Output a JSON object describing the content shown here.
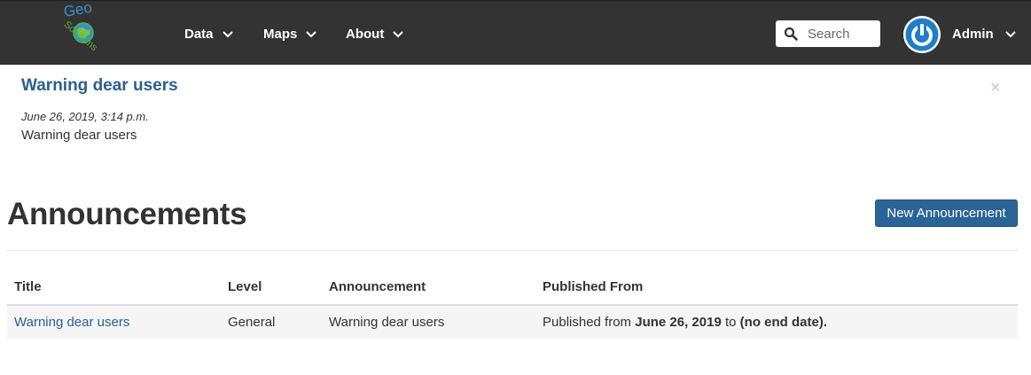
{
  "navbar": {
    "logo_text_top": "Geo",
    "logo_text_bottom": "Solutions",
    "menu": [
      {
        "label": "Data"
      },
      {
        "label": "Maps"
      },
      {
        "label": "About"
      }
    ],
    "search_placeholder": "Search",
    "user_label": "Admin",
    "colors": {
      "background": "#333333",
      "avatar_ring": "#1f7fc6"
    }
  },
  "alert": {
    "title": "Warning dear users",
    "date": "June 26, 2019, 3:14 p.m.",
    "body": "Warning dear users",
    "close_glyph": "×"
  },
  "page": {
    "title": "Announcements",
    "new_button": "New Announcement"
  },
  "table": {
    "headers": [
      "Title",
      "Level",
      "Announcement",
      "Published From"
    ],
    "rows": [
      {
        "title": "Warning dear users",
        "level": "General",
        "announcement": "Warning dear users",
        "published_prefix": "Published from",
        "published_start": "June 26, 2019",
        "published_mid": "to",
        "published_end": "(no end date)."
      }
    ]
  }
}
